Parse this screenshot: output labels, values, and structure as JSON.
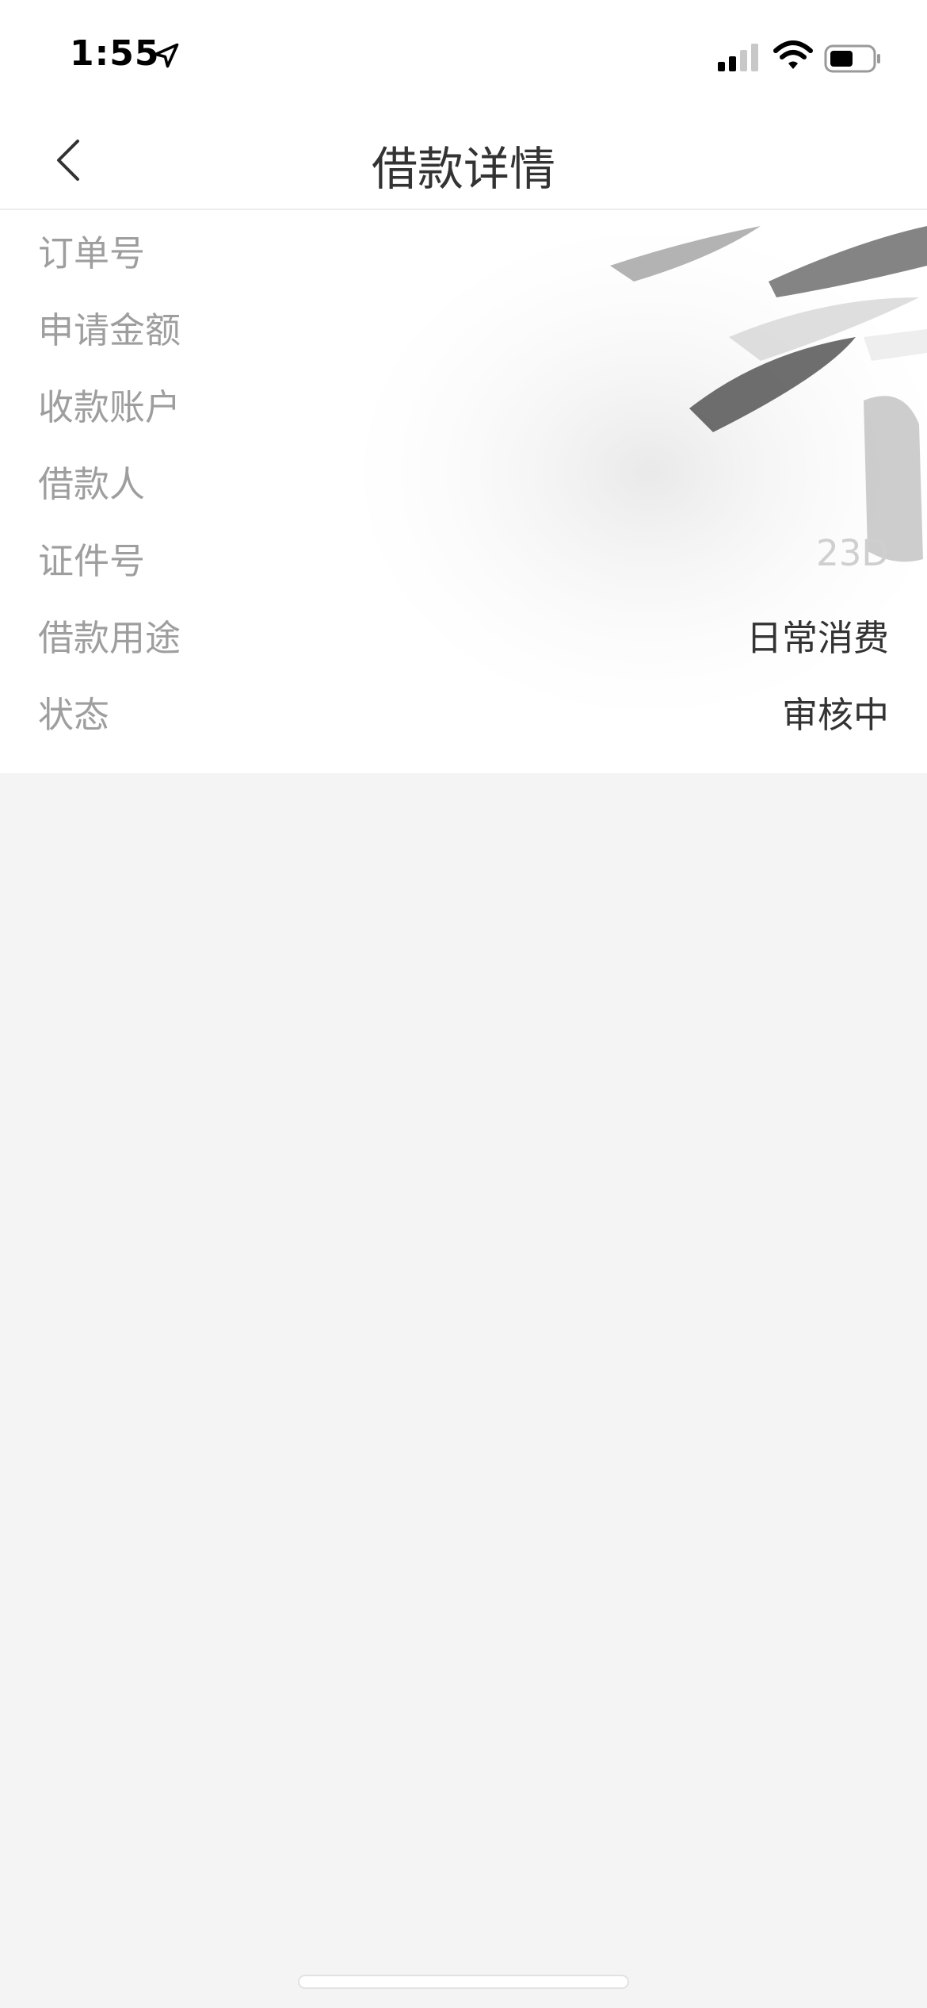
{
  "status_bar": {
    "time": "1:55",
    "icons": [
      "location-arrow-icon",
      "signal-icon",
      "wifi-icon",
      "battery-icon"
    ]
  },
  "nav": {
    "back_icon": "chevron-left-icon",
    "title": "借款详情"
  },
  "details": {
    "rows": [
      {
        "label": "订单号",
        "value": ""
      },
      {
        "label": "申请金额",
        "value": ""
      },
      {
        "label": "收款账户",
        "value": ""
      },
      {
        "label": "借款人",
        "value": ""
      },
      {
        "label": "证件号",
        "value": "23D"
      },
      {
        "label": "借款用途",
        "value": "日常消费"
      },
      {
        "label": "状态",
        "value": "审核中"
      }
    ]
  },
  "colors": {
    "label": "#9e9e9e",
    "value": "#333333",
    "page_bg": "#f4f4f4",
    "card_bg": "#ffffff"
  }
}
